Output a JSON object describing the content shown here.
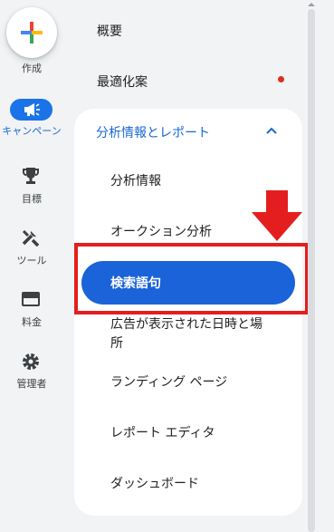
{
  "rail": {
    "create_label": "作成",
    "campaign_label": "キャンペーン",
    "goals_label": "目標",
    "tools_label": "ツール",
    "billing_label": "料金",
    "admin_label": "管理者"
  },
  "nav": {
    "overview": "概要",
    "recommendations": "最適化案",
    "section_title": "分析情報とレポート",
    "items": [
      "分析情報",
      "オークション分析",
      "検索語句",
      "広告が表示された日時と場",
      "所",
      "ランディング ページ",
      "レポート エディタ",
      "ダッシュボード"
    ]
  },
  "colors": {
    "accent": "#1a73e8",
    "active_pill": "#1a63d8",
    "highlight": "#e41e1e",
    "notification_dot": "#d93025"
  },
  "icons": [
    "plus-icon",
    "megaphone-icon",
    "trophy-icon",
    "tools-icon",
    "credit-card-icon",
    "gear-icon",
    "chevron-up-icon",
    "down-arrow-icon"
  ]
}
